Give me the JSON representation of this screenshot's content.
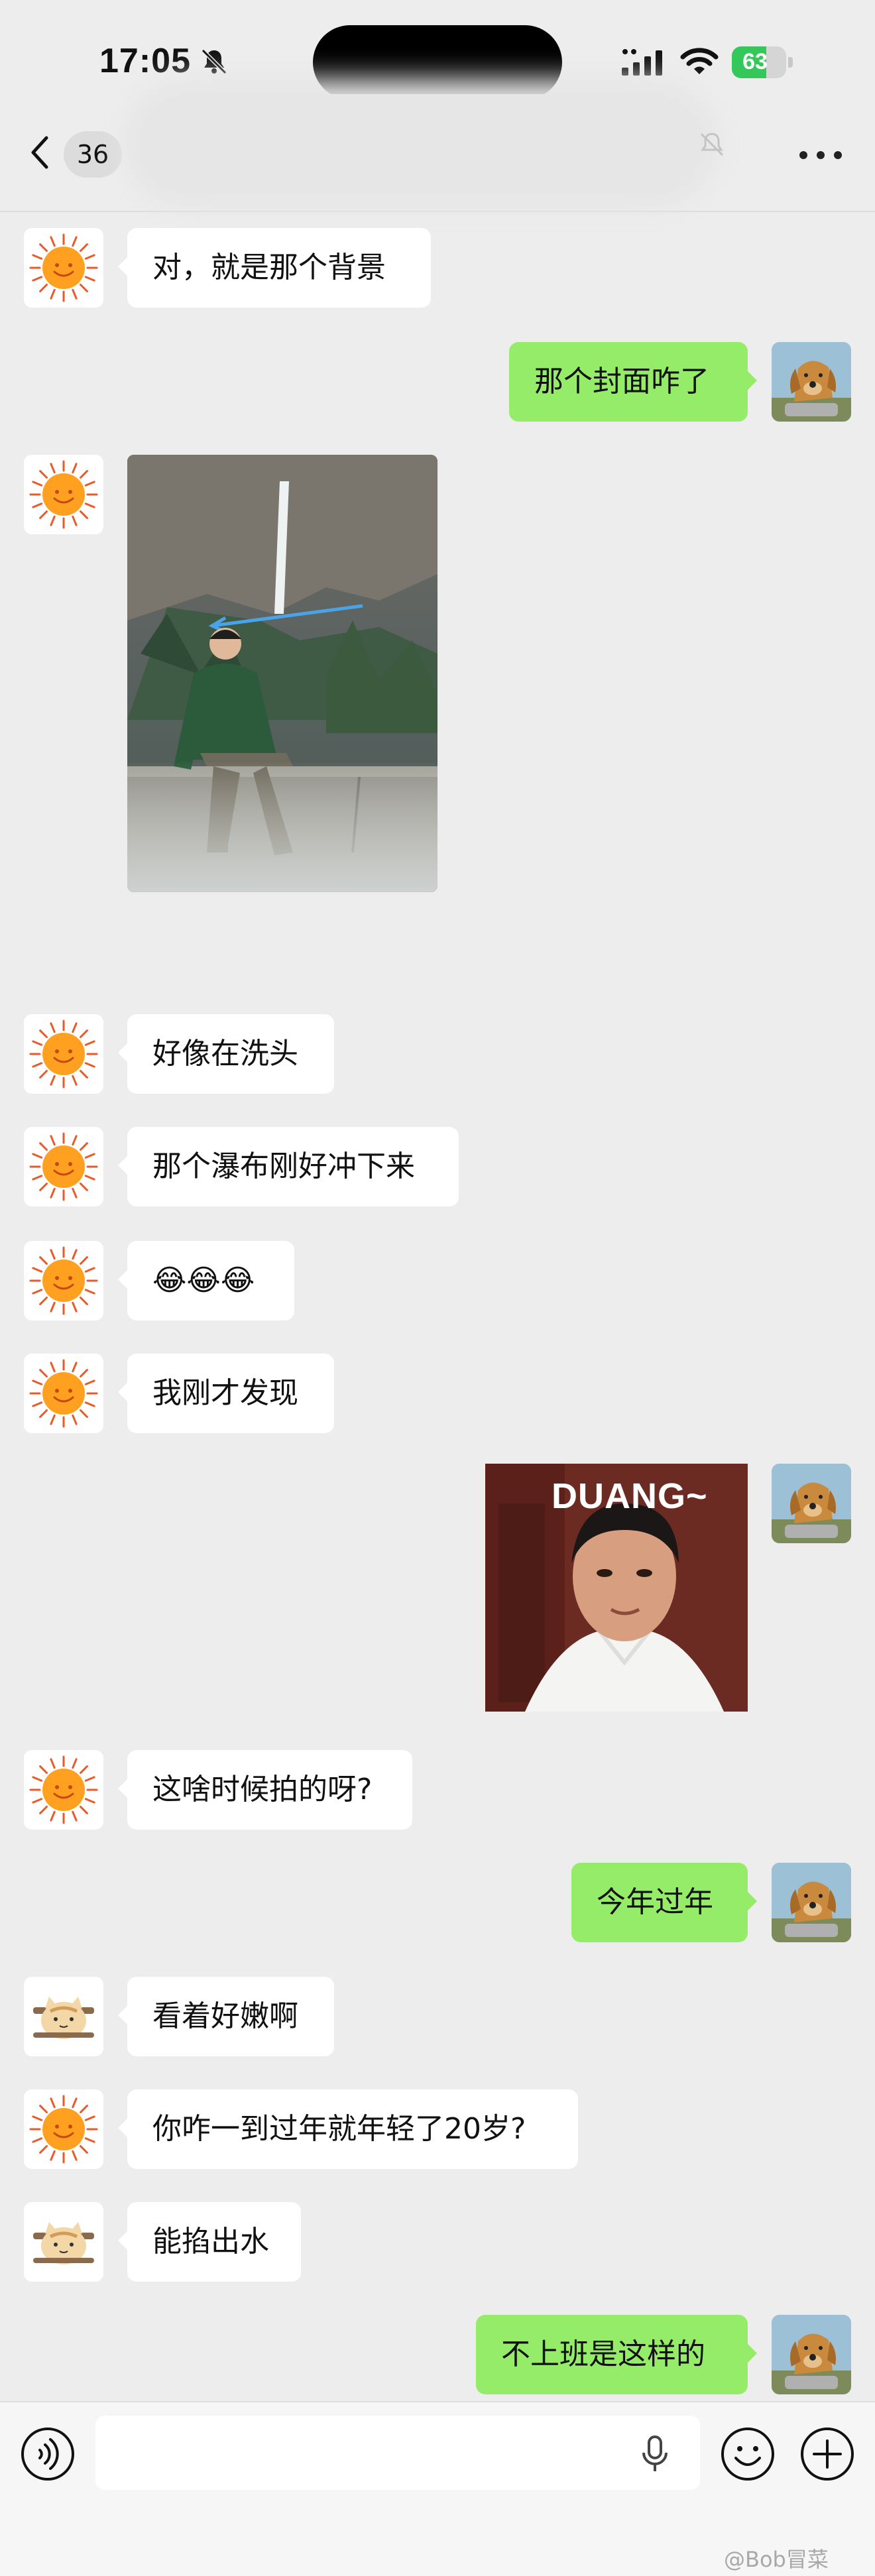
{
  "status_bar": {
    "time": "17:05",
    "battery_level": 63,
    "battery_text": "63",
    "icons": [
      "bell-off-icon",
      "cellular-signal-icon",
      "wifi-icon",
      "battery-charging-icon"
    ]
  },
  "nav": {
    "unread_count": "36",
    "icons": [
      "chevron-left-icon",
      "mute-bell-icon",
      "more-dots-icon"
    ]
  },
  "messages": [
    {
      "side": "left",
      "avatar": "sun",
      "type": "text",
      "text": "对，就是那个背景"
    },
    {
      "side": "right",
      "avatar": "dog",
      "type": "text",
      "text": "那个封面咋了"
    },
    {
      "side": "left",
      "avatar": "sun",
      "type": "image",
      "description": "photo"
    },
    {
      "side": "left",
      "avatar": "sun",
      "type": "text",
      "text": "好像在洗头"
    },
    {
      "side": "left",
      "avatar": "sun",
      "type": "text",
      "text": "那个瀑布刚好冲下来"
    },
    {
      "side": "left",
      "avatar": "sun",
      "type": "text",
      "text": "😂😂😂"
    },
    {
      "side": "left",
      "avatar": "sun",
      "type": "text",
      "text": "我刚才发现"
    },
    {
      "side": "right",
      "avatar": "dog",
      "type": "sticker",
      "text": "DUANG~"
    },
    {
      "side": "left",
      "avatar": "sun",
      "type": "text",
      "text": "这啥时候拍的呀?"
    },
    {
      "side": "right",
      "avatar": "dog",
      "type": "text",
      "text": "今年过年"
    },
    {
      "side": "left",
      "avatar": "cat",
      "type": "text",
      "text": "看着好嫩啊"
    },
    {
      "side": "left",
      "avatar": "sun",
      "type": "text",
      "text": "你咋一到过年就年轻了20岁?"
    },
    {
      "side": "left",
      "avatar": "cat",
      "type": "text",
      "text": "能掐出水"
    },
    {
      "side": "right",
      "avatar": "dog",
      "type": "text",
      "text": "不上班是这样的"
    }
  ],
  "input_bar": {
    "value": "",
    "icons": [
      "voice-mode-icon",
      "microphone-icon",
      "emoji-icon",
      "plus-icon"
    ]
  },
  "watermark": "@Bob冒菜",
  "colors": {
    "background": "#ededed",
    "bubble_self": "#95ec69",
    "bubble_other": "#ffffff",
    "battery_green": "#34c759"
  }
}
